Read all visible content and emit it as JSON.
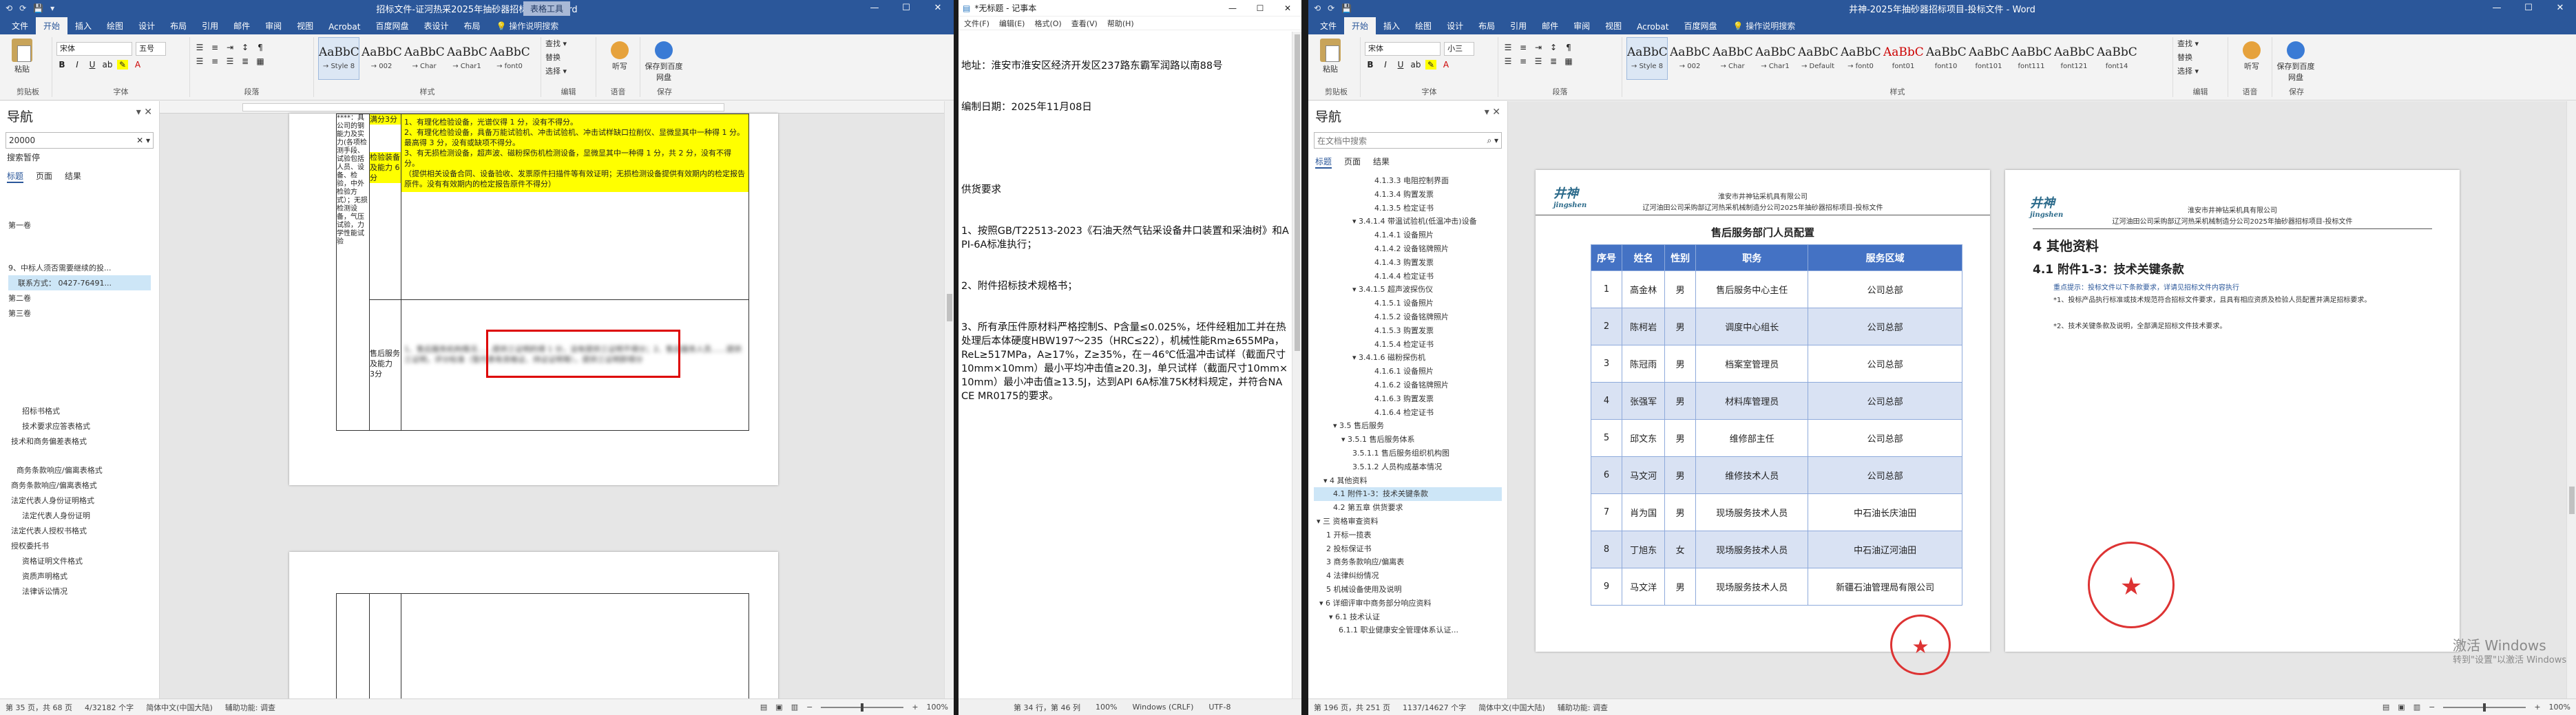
{
  "w1": {
    "qat": [
      "⟲",
      "⟳",
      "💾",
      "▾"
    ],
    "title": "招标文件-证河热采2025年抽砂器招标项目 - Word",
    "context_tab": "表格工具",
    "tabs": [
      "文件",
      "开始",
      "插入",
      "绘图",
      "设计",
      "布局",
      "引用",
      "邮件",
      "审阅",
      "视图",
      "Acrobat",
      "百度网盘",
      "表设计",
      "布局"
    ],
    "tell_me": "操作说明搜索",
    "clipboard_label": "剪贴板",
    "paste_label": "粘贴",
    "font_name": "宋体",
    "font_size": "五号",
    "font_label": "字体",
    "para_label": "段落",
    "styles_label": "样式",
    "styles": [
      {
        "sample": "AaBbCc",
        "name": "→ Style 8"
      },
      {
        "sample": "AaBbCc",
        "name": "→ 002"
      },
      {
        "sample": "AaBbCc",
        "name": "→ Char"
      },
      {
        "sample": "AaBbCc",
        "name": "→ Char1"
      },
      {
        "sample": "AaBbCc",
        "name": "→ font0"
      }
    ],
    "edit_items": [
      "查找 ▾",
      "替换",
      "选择 ▾"
    ],
    "edit_label": "编辑",
    "voice_btn": "听写",
    "voice_label": "语音",
    "save_btn": "保存到百度网盘",
    "save_label": "保存",
    "nav_title": "导航",
    "nav_search": "20000",
    "nav_sub": "搜索暂停",
    "nav_tabs": [
      "标题",
      "页面",
      "结果"
    ],
    "nav_items": [
      "第一卷",
      "9、中标人须否需要继续的投...",
      "联系方式：      0427-76491...",
      "第二卷",
      "第三卷",
      "招标书格式",
      "技术要求应答表格式",
      "技术和商务偏差表格式",
      "商务条款响应/偏离表格式",
      "商务条款响应/偏离表格式",
      "法定代表人身份证明格式",
      "法定代表人身份证明",
      "法定代表人授权书格式",
      "授权委托书",
      "资格证明文件格式",
      "资质声明格式",
      "法律诉讼情况"
    ],
    "table": {
      "label_col": "****：具公司的钢能力及实力(各项检测手段、试验包括人员、设备、检验，中外检验方式）；无损检测设备，气压试验，力学性能试验",
      "score_a": "满分3分",
      "row1_text": "1、有理化检验设备，光谱仪得 1 分，没有不得分。\n2、有理化检验设备，具备万能试验机、冲击试验机、冲击试样缺口拉削仪、显微显其中一种得 1 分。最高得 3 分，没有或缺项不得分。\n3、有无损检测设备，超声波、磁粉探伤机检测设备，显微显其中一种得 1 分，共 2 分，没有不得分。\n（提供相关设备合同、设备验收、发票原件扫描件等有效证明；无损检测设备提供有效期内的检定报告原件。没有有效期内的检定报告原件不得分）",
      "row1_label": "检验装备及能力 6分",
      "row2_label": "售后服务及能力",
      "row2_score": "3分",
      "row2_text": "1、售后服务机构情况……提供三证明的得 1 分，没有提供三证明不得分；2、售后服务人员……提供三证明，评分标准（暂代表有资格证、持证证明等），提供三证明即得分"
    },
    "status": [
      "第 35 页，共 68 页",
      "4/32182 个字",
      "简体中文(中国大陆)",
      "辅助功能: 调查"
    ],
    "zoom": "100%"
  },
  "w2": {
    "title": "*无标题 - 记事本",
    "menu": [
      "文件(F)",
      "编辑(E)",
      "格式(O)",
      "查看(V)",
      "帮助(H)"
    ],
    "lines": [
      "地址：淮安市淮安区经济开发区237路东霸军润路以南88号",
      "编制日期：2025年11月08日",
      "",
      "供货要求",
      "1、按照GB/T22513-2023《石油天然气钻采设备井口装置和采油树》和API-6A标准执行；",
      "2、附件招标技术规格书；",
      "3、所有承压件原材料严格控制S、P含量≤0.025%，坯件经粗加工并在热处理后本体硬度HBW197～235（HRC≤22），机械性能Rm≥655MPa，ReL≥517MPa，A≥17%，Z≥35%，在－46℃低温冲击试样（截面尺寸10mm×10mm）最小平均冲击值≥20.3J，单只试样（截面尺寸10mm×10mm）最小冲击值≥13.5J，达到API 6A标准75K材料规定，并符合NACE MR0175的要求。"
    ],
    "status": [
      "第 34 行，第 46 列",
      "100%",
      "Windows (CRLF)",
      "UTF-8"
    ]
  },
  "w3": {
    "title": "井神-2025年抽砂器招标项目-投标文件 - Word",
    "tabs": [
      "文件",
      "开始",
      "插入",
      "绘图",
      "设计",
      "布局",
      "引用",
      "邮件",
      "审阅",
      "视图",
      "Acrobat",
      "百度网盘",
      "操作说明搜索"
    ],
    "font_name": "宋体",
    "font_size": "小三",
    "styles": [
      {
        "sample": "AaBbCc",
        "name": "→ Style 8"
      },
      {
        "sample": "AaBbCc",
        "name": "→ 002"
      },
      {
        "sample": "AaBbCc",
        "name": "→ Char"
      },
      {
        "sample": "AaBbCcD",
        "name": "→ Char1"
      },
      {
        "sample": "AaBbCcD",
        "name": "→ Default"
      },
      {
        "sample": "AaBbCcD",
        "name": "→ font0"
      },
      {
        "sample": "AaBbCcDi",
        "name": "font01"
      },
      {
        "sample": "AaBbCcD",
        "name": "font10"
      },
      {
        "sample": "AaBbCcD",
        "name": "font101"
      },
      {
        "sample": "AaBbCcD",
        "name": "font111"
      },
      {
        "sample": "AaBbCcD",
        "name": "font121"
      },
      {
        "sample": "AaBbCcD",
        "name": "font14"
      }
    ],
    "edit_items": [
      "查找 ▾",
      "替换",
      "选择 ▾"
    ],
    "nav_title": "导航",
    "nav_search": "在文档中搜索",
    "nav_tabs": [
      "标题",
      "页面",
      "结果"
    ],
    "nav_items": [
      "4.1.3.3 电阻控制界面",
      "4.1.3.4 购置发票",
      "4.1.3.5 检定证书",
      "▾ 3.4.1.4 带温试验机(低温冲击)设备",
      "4.1.4.1 设备照片",
      "4.1.4.2 设备铭牌照片",
      "4.1.4.3 购置发票",
      "4.1.4.4 检定证书",
      "▾ 3.4.1.5 超声波探伤仪",
      "4.1.5.1 设备照片",
      "4.1.5.2 设备铭牌照片",
      "4.1.5.3 购置发票",
      "4.1.5.4 检定证书",
      "▾ 3.4.1.6 磁粉探伤机",
      "4.1.6.1 设备照片",
      "4.1.6.2 设备铭牌照片",
      "4.1.6.3 购置发票",
      "4.1.6.4 检定证书",
      "▾ 3.5 售后服务",
      "▾ 3.5.1 售后服务体系",
      "3.5.1.1 售后服务组织机构图",
      "3.5.1.2 人员构成基本情况",
      "▾ 4 其他资料",
      "4.1 附件1-3：技术关键条款",
      "4.2 第五章  供货要求",
      "▾ 三 资格审查资料",
      "1 开标一揽表",
      "2 投标保证书",
      "3 商务条款响应/偏离表",
      "4 法律纠纷情况",
      "5 机械设备使用及说明",
      "▾ 6 详细评审中商务部分响应资料",
      "▾ 6.1 技术认证",
      "6.1.1 职业健康安全管理体系认证..."
    ],
    "page_a": {
      "brand": "井神",
      "brand_sub": "jingshen",
      "hdr1": "淮安市井神钻采机具有限公司",
      "hdr2": "辽河油田公司采购部辽河热采机械制造分公司2025年抽砂器招标项目-投标文件",
      "table_title": "售后服务部门人员配置",
      "cols": [
        "序号",
        "姓名",
        "性别",
        "职务",
        "服务区域"
      ],
      "rows": [
        [
          "1",
          "高金林",
          "男",
          "售后服务中心主任",
          "公司总部"
        ],
        [
          "2",
          "陈柯岩",
          "男",
          "调度中心组长",
          "公司总部"
        ],
        [
          "3",
          "陈冠雨",
          "男",
          "档案室管理员",
          "公司总部"
        ],
        [
          "4",
          "张强军",
          "男",
          "材料库管理员",
          "公司总部"
        ],
        [
          "5",
          "邱文东",
          "男",
          "维修部主任",
          "公司总部"
        ],
        [
          "6",
          "马文河",
          "男",
          "维修技术人员",
          "公司总部"
        ],
        [
          "7",
          "肖为国",
          "男",
          "现场服务技术人员",
          "中石油长庆油田"
        ],
        [
          "8",
          "丁旭东",
          "女",
          "现场服务技术人员",
          "中石油辽河油田"
        ],
        [
          "9",
          "马文洋",
          "男",
          "现场服务技术人员",
          "新疆石油管理局有限公司"
        ]
      ]
    },
    "page_b": {
      "brand": "井神",
      "brand_sub": "jingshen",
      "hdr1": "淮安市井神钻采机具有限公司",
      "hdr2": "辽河油田公司采购部辽河热采机械制造分公司2025年抽砂器招标项目-投标文件",
      "h1": "4 其他资料",
      "h2": "4.1 附件1-3：技术关键条款",
      "p1": "重点提示：投标文件以下条款要求，详请见招标文件内容执行",
      "p2": "*1、投标产品执行标准或技术规范符合招标文件要求，且具有相应资质及检验人员配置并满足招标要求。",
      "p3": "*2、技术关键条款及说明，全部满足招标文件技术要求。"
    },
    "activate_line1": "激活 Windows",
    "activate_line2": "转到\"设置\"以激活 Windows。",
    "status": [
      "第 196 页，共 251 页",
      "1137/14627 个字",
      "简体中文(中国大陆)",
      "辅助功能: 调查"
    ],
    "zoom": "100%"
  }
}
